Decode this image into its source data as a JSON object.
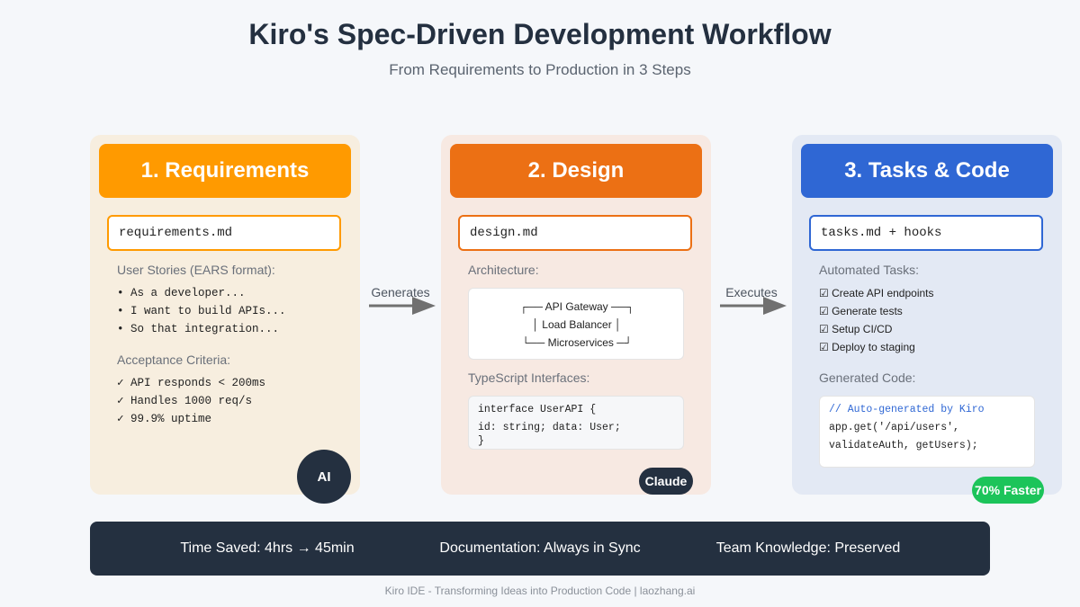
{
  "title": "Kiro's Spec-Driven Development Workflow",
  "subtitle": "From Requirements to Production in 3 Steps",
  "colors": {
    "requirements": "#ff9a00",
    "design": "#ec7014",
    "tasks": "#2f67d4",
    "dark": "#243040",
    "success": "#1cc45a"
  },
  "steps": [
    {
      "heading": "1. Requirements",
      "file": "requirements.md",
      "section1": "User Stories (EARS format):",
      "stories": [
        "• As a developer...",
        "• I want to build APIs...",
        "• So that integration..."
      ],
      "section2": "Acceptance Criteria:",
      "criteria": [
        "✓ API responds < 200ms",
        "✓ Handles 1000 req/s",
        "✓ 99.9% uptime"
      ],
      "badge": "AI"
    },
    {
      "heading": "2. Design",
      "file": "design.md",
      "section1": "Architecture:",
      "architecture": [
        "┌── API Gateway ──┐",
        "│ Load Balancer │",
        "└── Microservices ─┘"
      ],
      "section2": "TypeScript Interfaces:",
      "code": [
        "interface UserAPI {",
        "id: string; data: User;",
        "}"
      ],
      "badge": "Claude"
    },
    {
      "heading": "3. Tasks & Code",
      "file": "tasks.md + hooks",
      "section1": "Automated Tasks:",
      "tasks": [
        "☑ Create API endpoints",
        "☑ Generate tests",
        "☑ Setup CI/CD",
        "☑ Deploy to staging"
      ],
      "section2": "Generated Code:",
      "code": [
        "// Auto-generated by Kiro",
        "app.get('/api/users',",
        "validateAuth, getUsers);"
      ],
      "badge": "70% Faster"
    }
  ],
  "arrows": [
    "Generates",
    "Executes"
  ],
  "stats": [
    "Time Saved: 4hrs → 45min",
    "Documentation: Always in Sync",
    "Team Knowledge: Preserved"
  ],
  "footer": "Kiro IDE - Transforming Ideas into Production Code | laozhang.ai"
}
